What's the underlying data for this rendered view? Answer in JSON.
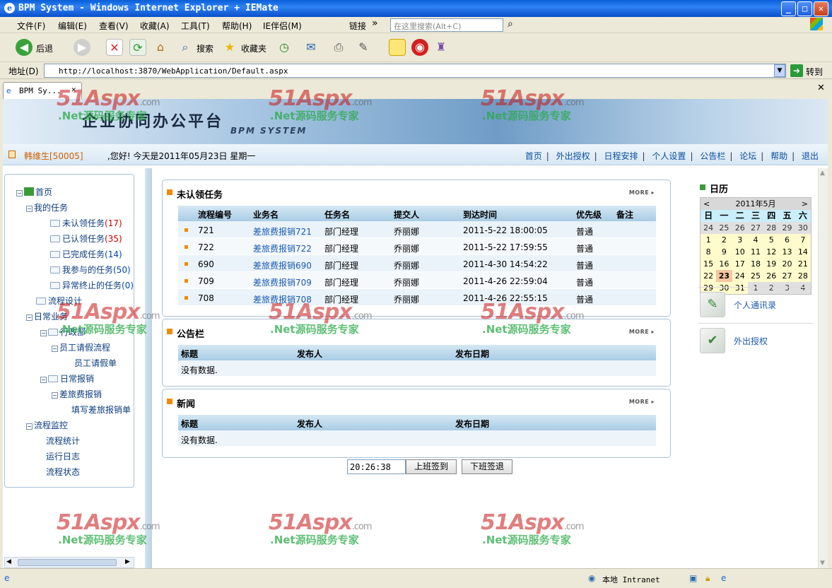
{
  "window": {
    "title": "BPM System - Windows Internet Explorer + IEMate",
    "minimize": "_",
    "maximize": "□",
    "close": "✕"
  },
  "menu": {
    "items": [
      "文件(F)",
      "编辑(E)",
      "查看(V)",
      "收藏(A)",
      "工具(T)",
      "帮助(H)",
      "IE伴侣(M)"
    ],
    "links_label": "链接",
    "links_chevron": "»",
    "search_placeholder": "在这里搜索(Alt+C)"
  },
  "toolbar": {
    "back": "后退",
    "search": "搜索",
    "favorites": "收藏夹"
  },
  "address": {
    "label": "地址(D)",
    "url": "http://localhost:3870/WebApplication/Default.aspx",
    "go": "转到"
  },
  "tab": {
    "label": "BPM Sy..."
  },
  "header": {
    "title": "企业协同办公平台",
    "subtitle": "BPM SYSTEM",
    "user": "韩维生[50005]",
    "greeting": ",您好!  今天是2011年05月23日  星期一",
    "links": [
      "首页",
      "外出授权",
      "日程安排",
      "个人设置",
      "公告栏",
      "论坛",
      "帮助",
      "退出"
    ]
  },
  "tree": {
    "root": "首页",
    "my_tasks": "我的任务",
    "unclaimed": "未认领任务",
    "unclaimed_count": "(17)",
    "claimed": "已认领任务",
    "claimed_count": "(35)",
    "completed": "已完成任务",
    "completed_count": "(14)",
    "participated": "我参与的任务",
    "participated_count": "(50)",
    "aborted": "异常终止的任务",
    "aborted_count": "(0)",
    "process_design": "流程设计",
    "daily": "日常业务",
    "admin": "行政部",
    "leave_process": "员工请假流程",
    "leave_form": "员工请假单",
    "reimburse": "日常报销",
    "travel": "差旅费报销",
    "travel_form": "填写差旅报销单",
    "monitor": "流程监控",
    "stats": "流程统计",
    "log": "运行日志",
    "status": "流程状态"
  },
  "tasks": {
    "title": "未认领任务",
    "more": "MORE ▸",
    "columns": [
      "流程编号",
      "业务名",
      "任务名",
      "提交人",
      "到达时间",
      "优先级",
      "备注"
    ],
    "rows": [
      {
        "id": "721",
        "biz": "差旅费报销721",
        "task": "部门经理",
        "submitter": "乔丽娜",
        "time": "2011-5-22 18:00:05",
        "priority": "普通"
      },
      {
        "id": "722",
        "biz": "差旅费报销722",
        "task": "部门经理",
        "submitter": "乔丽娜",
        "time": "2011-5-22 17:59:55",
        "priority": "普通"
      },
      {
        "id": "690",
        "biz": "差旅费报销690",
        "task": "部门经理",
        "submitter": "乔丽娜",
        "time": "2011-4-30 14:54:22",
        "priority": "普通"
      },
      {
        "id": "709",
        "biz": "差旅费报销709",
        "task": "部门经理",
        "submitter": "乔丽娜",
        "time": "2011-4-26 22:59:04",
        "priority": "普通"
      },
      {
        "id": "708",
        "biz": "差旅费报销708",
        "task": "部门经理",
        "submitter": "乔丽娜",
        "time": "2011-4-26 22:55:15",
        "priority": "普通"
      }
    ]
  },
  "notice": {
    "title": "公告栏",
    "more": "MORE ▸",
    "columns": [
      "标题",
      "发布人",
      "发布日期"
    ],
    "empty": "没有数据."
  },
  "news": {
    "title": "新闻",
    "more": "MORE ▸",
    "columns": [
      "标题",
      "发布人",
      "发布日期"
    ],
    "empty": "没有数据."
  },
  "attendance": {
    "clock": "20:26:38",
    "checkin": "上班签到",
    "checkout": "下班签退"
  },
  "calendar": {
    "title": "日历",
    "month": "2011年5月",
    "prev": "<",
    "next": ">",
    "dow": [
      "日",
      "一",
      "二",
      "三",
      "四",
      "五",
      "六"
    ],
    "weeks": [
      [
        "24",
        "25",
        "26",
        "27",
        "28",
        "29",
        "30"
      ],
      [
        "1",
        "2",
        "3",
        "4",
        "5",
        "6",
        "7"
      ],
      [
        "8",
        "9",
        "10",
        "11",
        "12",
        "13",
        "14"
      ],
      [
        "15",
        "16",
        "17",
        "18",
        "19",
        "20",
        "21"
      ],
      [
        "22",
        "23",
        "24",
        "25",
        "26",
        "27",
        "28"
      ],
      [
        "29",
        "30",
        "31",
        "1",
        "2",
        "3",
        "4"
      ]
    ],
    "today": "23"
  },
  "quicklinks": [
    "个人通讯录",
    "外出授权"
  ],
  "watermark": {
    "brand": "51Aspx",
    "domain": ".com",
    "slogan": ".Net源码服务专家"
  },
  "status": {
    "zone": "本地 Intranet"
  }
}
